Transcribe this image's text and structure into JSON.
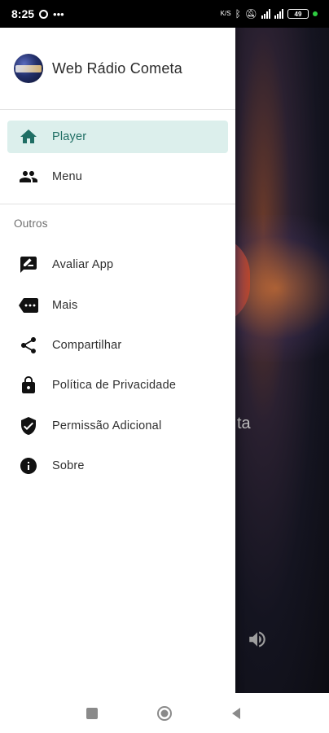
{
  "status_bar": {
    "time": "8:25",
    "battery_level": "49"
  },
  "drawer": {
    "app_title": "Web Rádio Cometa",
    "primary_items": [
      {
        "label": "Player",
        "icon": "home-icon",
        "active": true
      },
      {
        "label": "Menu",
        "icon": "people-icon",
        "active": false
      }
    ],
    "section_label": "Outros",
    "other_items": [
      {
        "label": "Avaliar App",
        "icon": "rate-review-icon"
      },
      {
        "label": "Mais",
        "icon": "more-tag-icon"
      },
      {
        "label": "Compartilhar",
        "icon": "share-icon"
      },
      {
        "label": "Política de Privacidade",
        "icon": "lock-icon"
      },
      {
        "label": "Permissão Adicional",
        "icon": "verified-shield-icon"
      },
      {
        "label": "Sobre",
        "icon": "info-icon"
      }
    ]
  },
  "background_app": {
    "title_fragment": "ta"
  },
  "colors": {
    "accent": "#1f6e64",
    "active_bg": "#dcefec",
    "icon_dark": "#111111"
  }
}
